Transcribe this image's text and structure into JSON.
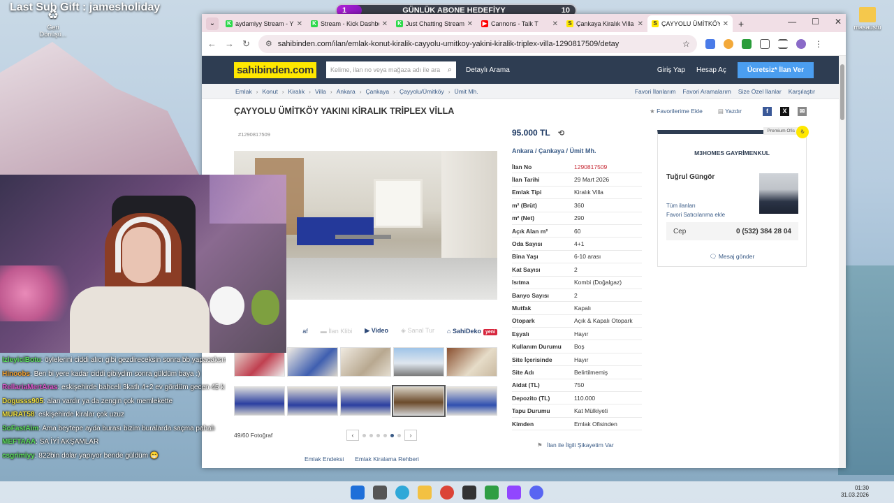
{
  "overlay": {
    "last_sub": "Last Sub Gift : jamesholiday",
    "goal_label": "GÜNLÜK ABONE HEDEFİYY",
    "goal_current": "1",
    "goal_target": "10",
    "goal_progress": 0.1
  },
  "desktop": {
    "recycle_label": "Geri Dönüşü...",
    "folder_label": "masaüstü"
  },
  "browser": {
    "tabs": [
      {
        "label": "aydamiyy Stream - Y",
        "icon": "kick-icon",
        "color": "#2bd94a"
      },
      {
        "label": "Stream - Kick Dashbo",
        "icon": "kick-icon",
        "color": "#2bd94a"
      },
      {
        "label": "Just Chatting Stream",
        "icon": "kick-icon",
        "color": "#2bd94a"
      },
      {
        "label": "Cannons - Talk T",
        "icon": "youtube-icon",
        "color": "#ff0000"
      },
      {
        "label": "Çankaya Kiralık Villa",
        "icon": "sahibinden-icon",
        "color": "#ffe800"
      },
      {
        "label": "ÇAYYOLU ÜMİTKÖY",
        "icon": "sahibinden-icon",
        "color": "#ffe800"
      }
    ],
    "url": "sahibinden.com/ilan/emlak-konut-kiralik-cayyolu-umitkoy-yakini-kiralik-triplex-villa-1290817509/detay"
  },
  "site": {
    "logo": "sahibinden.com",
    "search_placeholder": "Kelime, ilan no veya mağaza adı ile ara",
    "detailed_search": "Detaylı Arama",
    "login": "Giriş Yap",
    "register": "Hesap Aç",
    "cta": "Ücretsiz* İlan Ver",
    "breadcrumbs": [
      "Emlak",
      "Konut",
      "Kiralık",
      "Villa",
      "Ankara",
      "Çankaya",
      "Çayyolu/Ümitköy",
      "Ümit Mh."
    ],
    "crumb_links": [
      "Favori İlanlarım",
      "Favori Aramalarım",
      "Size Özel İlanlar",
      "Karşılaştır"
    ]
  },
  "listing": {
    "title": "ÇAYYOLU ÜMİTKÖY YAKINI KİRALIK TRİPLEX VİLLA",
    "fav": "Favorilerime Ekle",
    "print": "Yazdır",
    "ad_id": "#1290817509",
    "price": "95.000 TL",
    "location": "Ankara  /  Çankaya  /  Ümit Mh.",
    "media": {
      "map": "af",
      "street": "İlan Klibi",
      "video": "Video",
      "virtual": "Sanal Tur",
      "sahideko": "SahiDeko",
      "new": "yeni"
    },
    "photo_count": "49/60 Fotoğraf",
    "details": [
      [
        "İlan No",
        "1290817509"
      ],
      [
        "İlan Tarihi",
        "29 Mart 2026"
      ],
      [
        "Emlak Tipi",
        "Kiralık Villa"
      ],
      [
        "m² (Brüt)",
        "360"
      ],
      [
        "m² (Net)",
        "290"
      ],
      [
        "Açık Alan m²",
        "60"
      ],
      [
        "Oda Sayısı",
        "4+1"
      ],
      [
        "Bina Yaşı",
        "6-10 arası"
      ],
      [
        "Kat Sayısı",
        "2"
      ],
      [
        "Isıtma",
        "Kombi (Doğalgaz)"
      ],
      [
        "Banyo Sayısı",
        "2"
      ],
      [
        "Mutfak",
        "Kapalı"
      ],
      [
        "Otopark",
        "Açık & Kapalı Otopark"
      ],
      [
        "Eşyalı",
        "Hayır"
      ],
      [
        "Kullanım Durumu",
        "Boş"
      ],
      [
        "Site İçerisinde",
        "Hayır"
      ],
      [
        "Site Adı",
        "Belirtilmemiş"
      ],
      [
        "Aidat (TL)",
        "750"
      ],
      [
        "Depozito (TL)",
        "110.000"
      ],
      [
        "Tapu Durumu",
        "Kat Mülkiyeti"
      ],
      [
        "Kimden",
        "Emlak Ofisinden"
      ]
    ],
    "report": "İlan ile İlgili Şikayetim Var",
    "footer_links": [
      "Emlak Endeksi",
      "Emlak Kiralama Rehberi"
    ]
  },
  "seller": {
    "badge": "Premium Ofis",
    "firm": "M3HOMES GAYRİMENKUL",
    "name": "Tuğrul Güngör",
    "all_ads": "Tüm ilanları",
    "fav_seller": "Favori Satıcılarıma ekle",
    "phone_label": "Cep",
    "phone": "0 (532) 384 28 04",
    "message": "Mesaj gönder"
  },
  "chat": [
    {
      "user": "IzleyiciBotu",
      "color": "#5ee05e",
      "msg": "öylelerini ciddi alıcı gibi gezdireceksin sonra bb yapacaksın"
    },
    {
      "user": "Hinoobs",
      "color": "#f0a030",
      "msg": "Ben bi yere kadar ciddi gibiydim sonra güldüm baya :)"
    },
    {
      "user": "RellariaMertAras",
      "color": "#e05ad0",
      "msg": "eskişehirde bahceli 3katlı 4+2 ev gördüm gecen 45 k kira diyodu"
    },
    {
      "user": "Dogusss905",
      "color": "#f0e040",
      "msg": "alan vardır ya da zengin çok memlekette"
    },
    {
      "user": "MURAT58",
      "color": "#f0e040",
      "msg": "eskişehirde kiralar çok uzuz"
    },
    {
      "user": "SoFastAim",
      "color": "#5ee05e",
      "msg": "Ama beytepe ayda burası bizim buralarda saçma pahalı"
    },
    {
      "user": "MEFTAAA",
      "color": "#5ee05e",
      "msg": "SA İYİ AKŞAMLAR"
    },
    {
      "user": "csgrimiyy",
      "color": "#5ee05e",
      "msg": "822bin dolar yapıyor bende güldüm 😁"
    }
  ],
  "clock": {
    "time": "01:30",
    "date": "31.03.2026"
  }
}
